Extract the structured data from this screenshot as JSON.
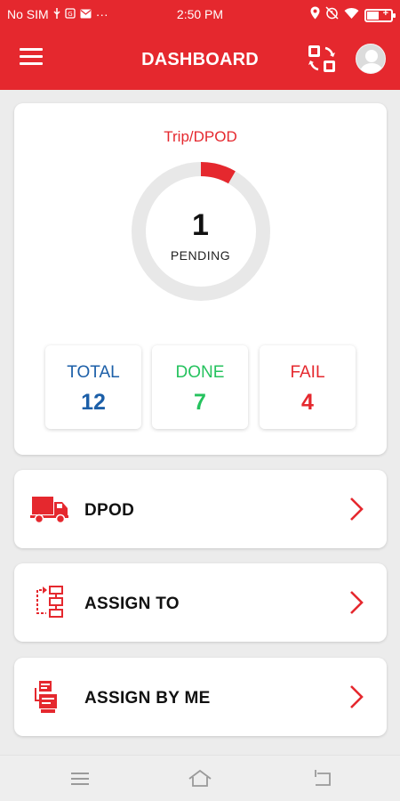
{
  "status_bar": {
    "carrier": "No SIM",
    "time": "2:50 PM",
    "more_indicator": "···"
  },
  "app_bar": {
    "title": "DASHBOARD",
    "menu_icon": "hamburger-menu-icon",
    "switch_icon": "switch-account-icon",
    "avatar_icon": "user-avatar-icon"
  },
  "summary": {
    "label": "Trip/DPOD",
    "pending_count": "1",
    "pending_label": "PENDING",
    "pending_fraction": 0.083,
    "stats": {
      "total_label": "TOTAL",
      "total_value": "12",
      "done_label": "DONE",
      "done_value": "7",
      "fail_label": "FAIL",
      "fail_value": "4"
    }
  },
  "menu": [
    {
      "label": "DPOD",
      "icon": "delivery-truck-icon"
    },
    {
      "label": "ASSIGN TO",
      "icon": "assign-to-icon"
    },
    {
      "label": "ASSIGN BY ME",
      "icon": "assign-by-me-icon"
    }
  ],
  "colors": {
    "brand_red": "#e5282e",
    "total_blue": "#1c5fa8",
    "done_green": "#25c25e",
    "fail_red": "#e5282e",
    "donut_track": "#e8e8e8"
  }
}
